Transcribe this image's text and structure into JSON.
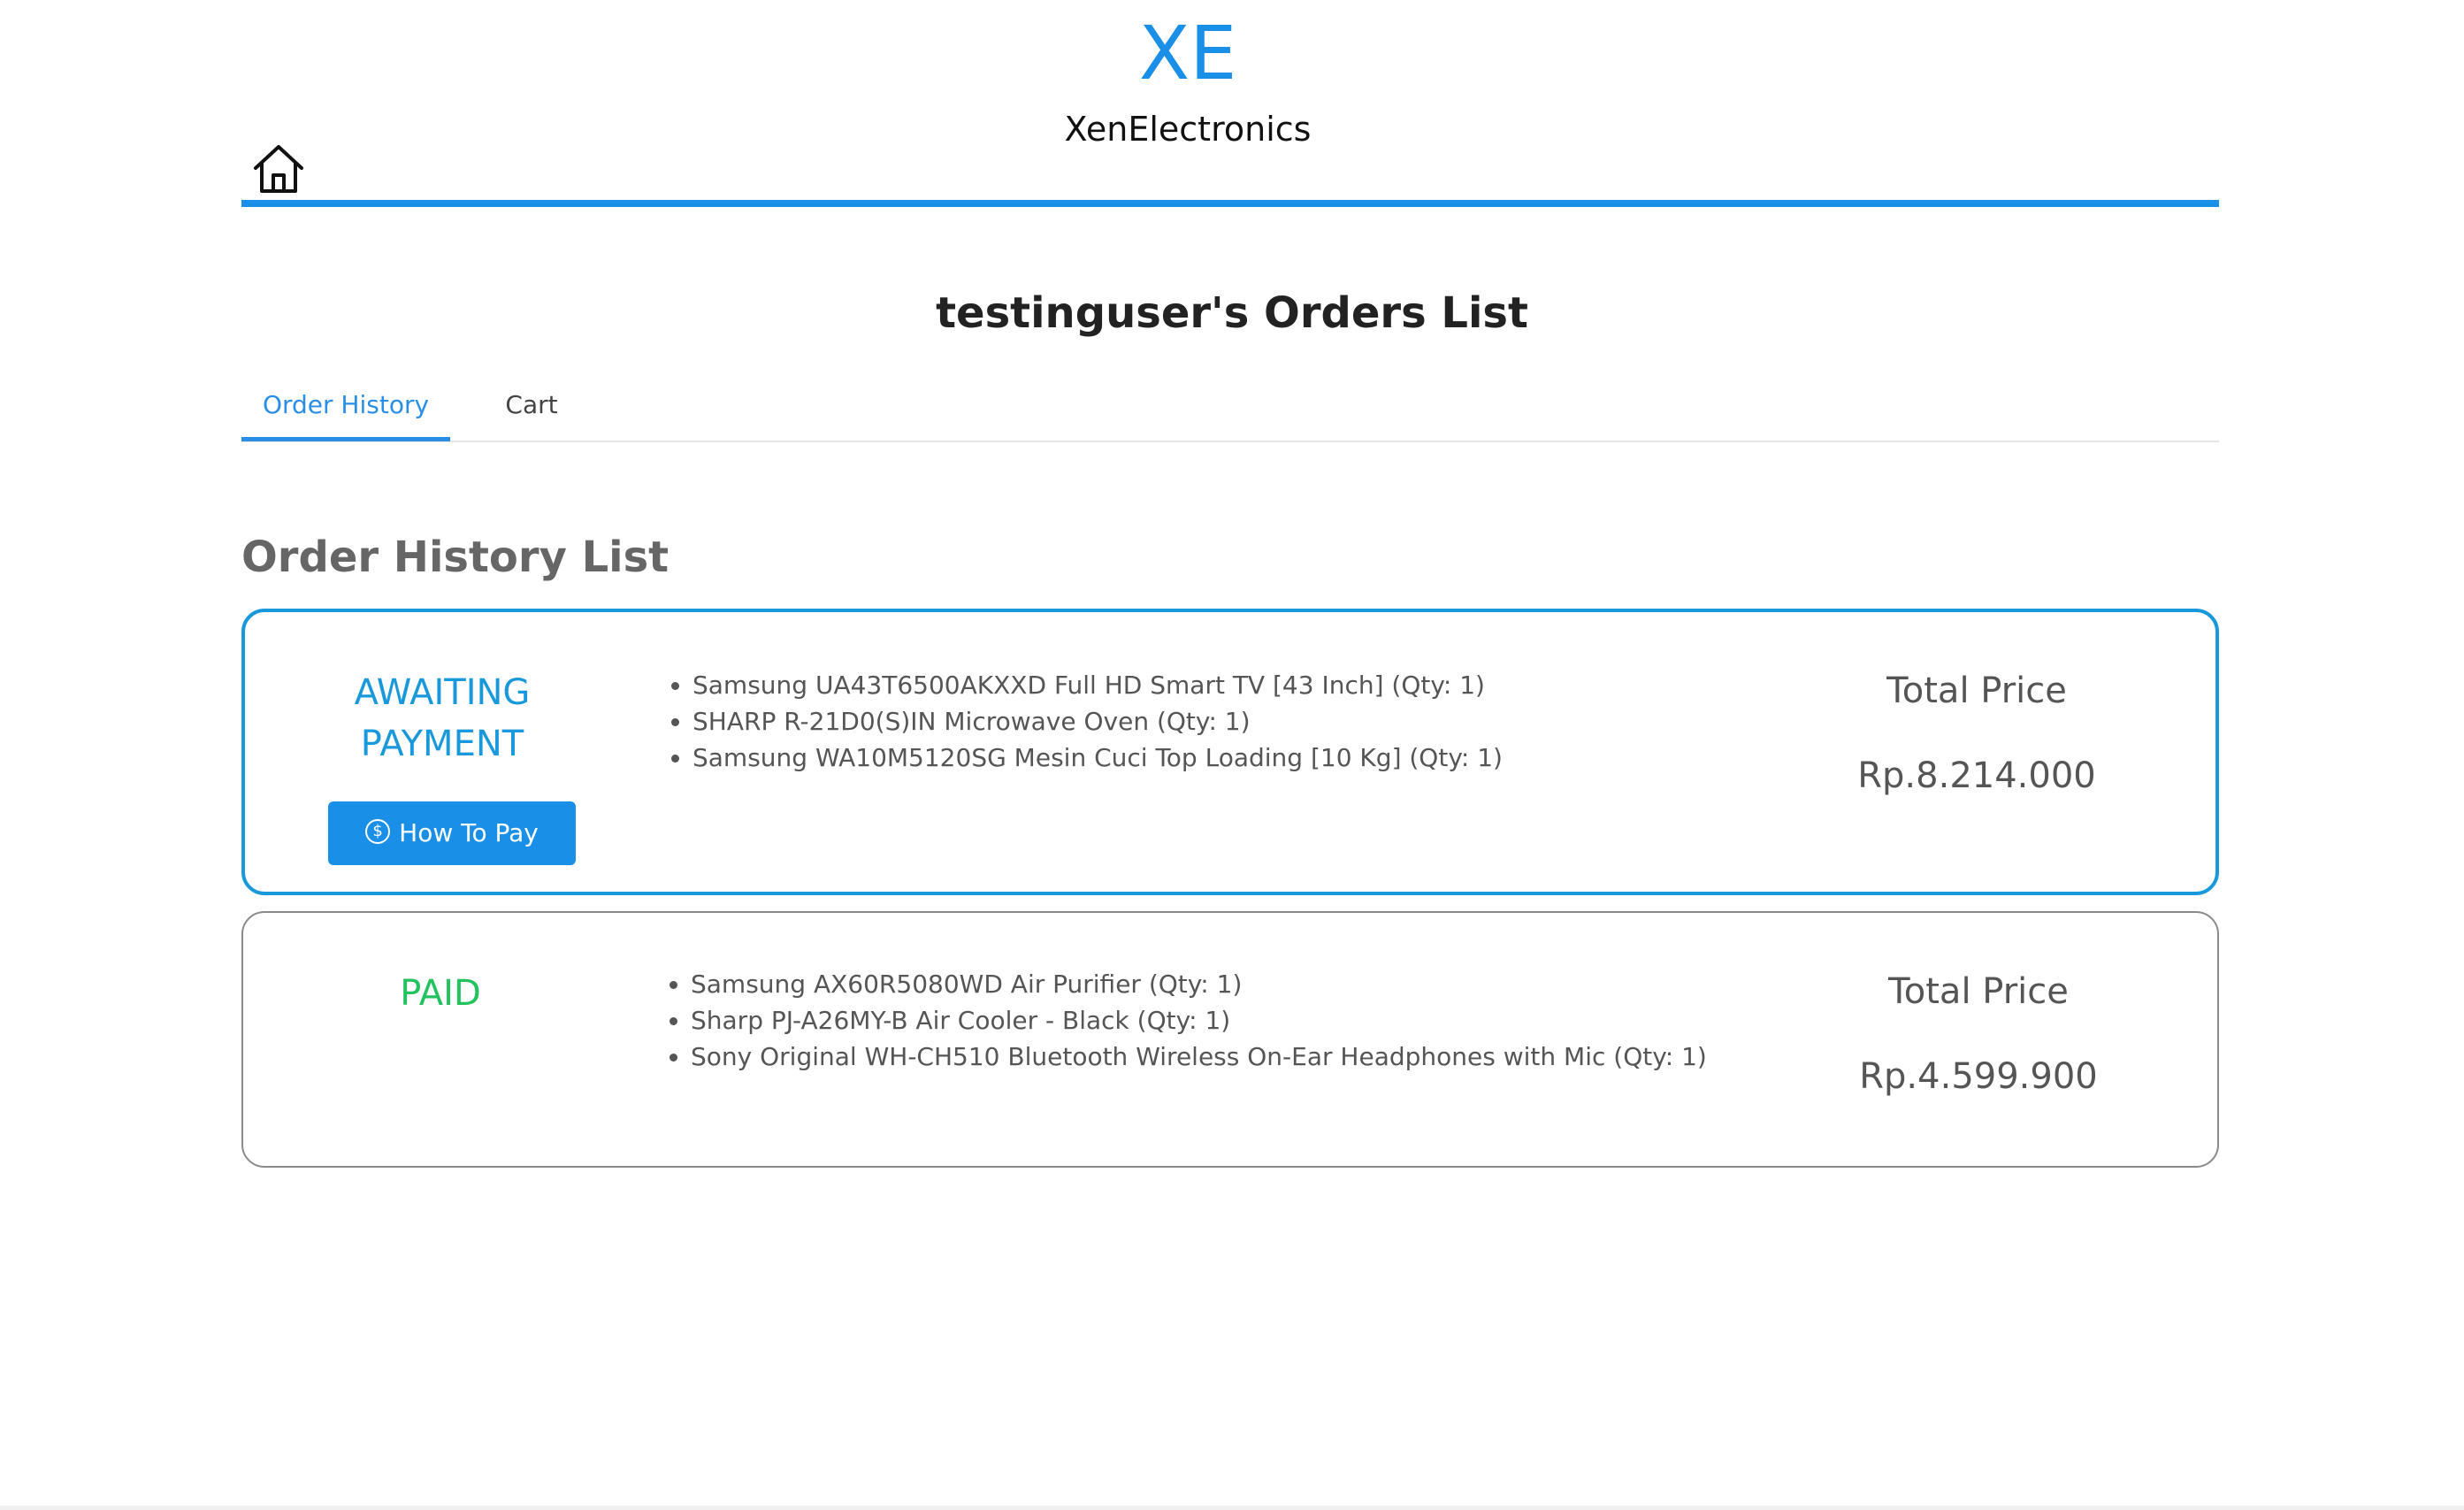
{
  "brand": {
    "logo": "XE",
    "name": "XenElectronics"
  },
  "nav": {
    "home_icon": "home-icon"
  },
  "page": {
    "title": "testinguser's Orders List"
  },
  "tabs": [
    {
      "label": "Order History",
      "active": true
    },
    {
      "label": "Cart",
      "active": false
    }
  ],
  "section": {
    "title": "Order History List"
  },
  "orders": [
    {
      "status_line1": "AWAITING",
      "status_line2": "PAYMENT",
      "status_color": "#1a98dc",
      "button_label": "How To Pay",
      "button_icon": "dollar-circle-icon",
      "items": [
        "Samsung UA43T6500AKXXD Full HD Smart TV [43 Inch] (Qty: 1)",
        "SHARP R-21D0(S)IN Microwave Oven (Qty: 1)",
        "Samsung WA10M5120SG Mesin Cuci Top Loading [10 Kg] (Qty: 1)"
      ],
      "price_label": "Total Price",
      "price_value": "Rp.8.214.000"
    },
    {
      "status_line1": "PAID",
      "status_color": "#22c25e",
      "items": [
        "Samsung AX60R5080WD Air Purifier (Qty: 1)",
        "Sharp PJ-A26MY-B Air Cooler - Black (Qty: 1)",
        "Sony Original WH-CH510 Bluetooth Wireless On-Ear Headphones with Mic (Qty: 1)"
      ],
      "price_label": "Total Price",
      "price_value": "Rp.4.599.900"
    }
  ],
  "colors": {
    "accent": "#1a8fe8",
    "awaiting": "#1a98dc",
    "paid": "#22c25e"
  }
}
